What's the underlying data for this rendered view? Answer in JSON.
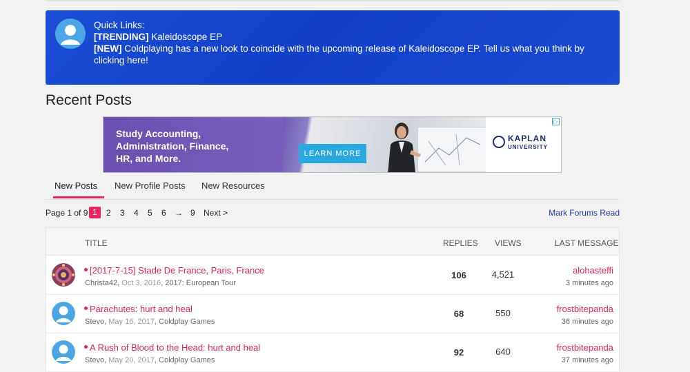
{
  "quick_links": {
    "heading": "Quick Links:",
    "trending_tag": "[TRENDING]",
    "trending_text": " Kaleidoscope EP",
    "new_tag": "[NEW]",
    "new_text": " Coldplaying has a new look to coincide with the upcoming release of Kaleidoscope EP. Tell us what you think by clicking here!"
  },
  "section_title": "Recent Posts",
  "ad": {
    "headline_1": "Study Accounting,",
    "headline_2": "Administration, Finance,",
    "headline_3": "HR, and More.",
    "button": "LEARN MORE",
    "brand": "KAPLAN",
    "brand_sub": "UNIVERSITY",
    "choice_icon": "▷"
  },
  "tabs": [
    {
      "label": "New Posts"
    },
    {
      "label": "New Profile Posts"
    },
    {
      "label": "New Resources"
    }
  ],
  "pager": {
    "page_of": "Page 1 of 9",
    "current": "1",
    "pages": [
      "2",
      "3",
      "4",
      "5",
      "6"
    ],
    "arrow": "→",
    "last": "9",
    "next": "Next >"
  },
  "mark_read": "Mark Forums Read",
  "table": {
    "col_title": "TITLE",
    "col_replies": "REPLIES",
    "col_views": "VIEWS",
    "col_last": "LAST MESSAGE",
    "rows": [
      {
        "title": "[2017-7-15] Stade De France, Paris, France",
        "author": "Christa42",
        "date": "Oct 3, 2016",
        "forum": "2017: European Tour",
        "replies": "106",
        "views": "4,521",
        "last_user": "alohasteffi",
        "last_time": "3 minutes ago"
      },
      {
        "title": "Parachutes: hurt and heal",
        "author": "Stevo",
        "date": "May 16, 2017",
        "forum": "Coldplay Games",
        "replies": "68",
        "views": "550",
        "last_user": "frostbitepanda",
        "last_time": "36 minutes ago"
      },
      {
        "title": "A Rush of Blood to the Head: hurt and heal",
        "author": "Stevo",
        "date": "May 20, 2017",
        "forum": "Coldplay Games",
        "replies": "92",
        "views": "640",
        "last_user": "frostbitepanda",
        "last_time": "37 minutes ago"
      }
    ]
  },
  "colors": {
    "accent": "#e8245a",
    "banner": "#1a4fd6",
    "link_blue": "#1f3aa8"
  }
}
